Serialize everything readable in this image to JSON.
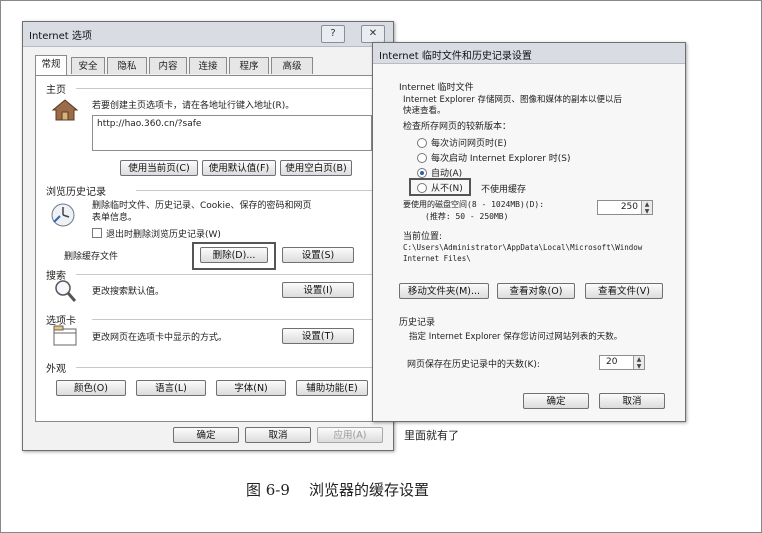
{
  "internet_options": {
    "title": "Internet 选项",
    "help_icon": "?",
    "close_icon": "✕",
    "tabs": [
      "常规",
      "安全",
      "隐私",
      "内容",
      "连接",
      "程序",
      "高级"
    ],
    "home": {
      "section": "主页",
      "desc": "若要创建主页选项卡，请在各地址行键入地址(R)。",
      "url": "http://hao.360.cn/?safe",
      "use_current": "使用当前页(C)",
      "use_default": "使用默认值(F)",
      "use_blank": "使用空白页(B)"
    },
    "history": {
      "section": "浏览历史记录",
      "desc_line1": "删除临时文件、历史记录、Cookie、保存的密码和网页",
      "desc_line2": "表单信息。",
      "checkbox": "退出时删除浏览历史记录(W)",
      "cache_label": "删除缓存文件",
      "delete_btn": "删除(D)...",
      "settings_btn": "设置(S)"
    },
    "search": {
      "section": "搜索",
      "desc": "更改搜索默认值。",
      "settings_btn": "设置(I)"
    },
    "tabs_section": {
      "section": "选项卡",
      "desc": "更改网页在选项卡中显示的方式。",
      "settings_btn": "设置(T)"
    },
    "appearance": {
      "section": "外观",
      "colors": "颜色(O)",
      "languages": "语言(L)",
      "fonts": "字体(N)",
      "accessibility": "辅助功能(E)"
    },
    "ok": "确定",
    "cancel": "取消",
    "apply": "应用(A)"
  },
  "temp_files": {
    "title": "Internet 临时文件和历史记录设置",
    "section": "Internet 临时文件",
    "desc_line1": "Internet Explorer 存储网页、图像和媒体的副本以便以后",
    "desc_line2": "快速查看。",
    "check_label": "检查所存网页的较新版本：",
    "options": [
      "每次访问网页时(E)",
      "每次启动 Internet Explorer 时(S)",
      "自动(A)",
      "从不(N)"
    ],
    "selected_option": "自动(A)",
    "never_note": "不使用缓存",
    "disk_label": "要使用的磁盘空间(8 - 1024MB)(D):",
    "disk_hint": "(推荐: 50 - 250MB)",
    "disk_value": "250",
    "location_label": "当前位置:",
    "location_path1": "C:\\Users\\Administrator\\AppData\\Local\\Microsoft\\Window",
    "location_path2": "Internet Files\\",
    "move_folder": "移动文件夹(M)...",
    "view_objects": "查看对象(O)",
    "view_files": "查看文件(V)",
    "history_section": "历史记录",
    "history_desc": "指定 Internet Explorer 保存您访问过网站列表的天数。",
    "days_label": "网页保存在历史记录中的天数(K):",
    "days_value": "20",
    "ok": "确定",
    "cancel": "取消"
  },
  "behind_text": "里面就有了",
  "caption": "图 6-9    浏览器的缓存设置"
}
